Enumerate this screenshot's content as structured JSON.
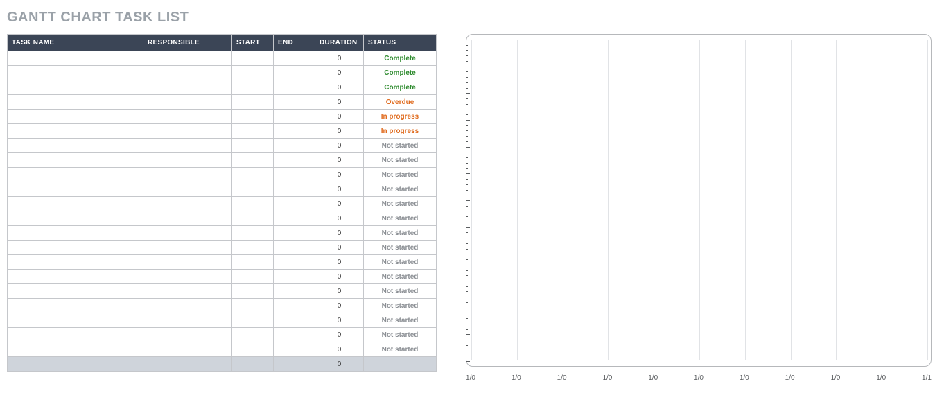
{
  "title": "GANTT CHART TASK LIST",
  "columns": {
    "task": "TASK NAME",
    "responsible": "RESPONSIBLE",
    "start": "START",
    "end": "END",
    "duration": "DURATION",
    "status": "STATUS"
  },
  "rows": [
    {
      "task": "",
      "responsible": "",
      "start": "",
      "end": "",
      "duration": "0",
      "status": "Complete",
      "statusClass": "complete"
    },
    {
      "task": "",
      "responsible": "",
      "start": "",
      "end": "",
      "duration": "0",
      "status": "Complete",
      "statusClass": "complete"
    },
    {
      "task": "",
      "responsible": "",
      "start": "",
      "end": "",
      "duration": "0",
      "status": "Complete",
      "statusClass": "complete"
    },
    {
      "task": "",
      "responsible": "",
      "start": "",
      "end": "",
      "duration": "0",
      "status": "Overdue",
      "statusClass": "overdue"
    },
    {
      "task": "",
      "responsible": "",
      "start": "",
      "end": "",
      "duration": "0",
      "status": "In progress",
      "statusClass": "inprogress"
    },
    {
      "task": "",
      "responsible": "",
      "start": "",
      "end": "",
      "duration": "0",
      "status": "In progress",
      "statusClass": "inprogress"
    },
    {
      "task": "",
      "responsible": "",
      "start": "",
      "end": "",
      "duration": "0",
      "status": "Not started",
      "statusClass": "notstarted"
    },
    {
      "task": "",
      "responsible": "",
      "start": "",
      "end": "",
      "duration": "0",
      "status": "Not started",
      "statusClass": "notstarted"
    },
    {
      "task": "",
      "responsible": "",
      "start": "",
      "end": "",
      "duration": "0",
      "status": "Not started",
      "statusClass": "notstarted"
    },
    {
      "task": "",
      "responsible": "",
      "start": "",
      "end": "",
      "duration": "0",
      "status": "Not started",
      "statusClass": "notstarted"
    },
    {
      "task": "",
      "responsible": "",
      "start": "",
      "end": "",
      "duration": "0",
      "status": "Not started",
      "statusClass": "notstarted"
    },
    {
      "task": "",
      "responsible": "",
      "start": "",
      "end": "",
      "duration": "0",
      "status": "Not started",
      "statusClass": "notstarted"
    },
    {
      "task": "",
      "responsible": "",
      "start": "",
      "end": "",
      "duration": "0",
      "status": "Not started",
      "statusClass": "notstarted"
    },
    {
      "task": "",
      "responsible": "",
      "start": "",
      "end": "",
      "duration": "0",
      "status": "Not started",
      "statusClass": "notstarted"
    },
    {
      "task": "",
      "responsible": "",
      "start": "",
      "end": "",
      "duration": "0",
      "status": "Not started",
      "statusClass": "notstarted"
    },
    {
      "task": "",
      "responsible": "",
      "start": "",
      "end": "",
      "duration": "0",
      "status": "Not started",
      "statusClass": "notstarted"
    },
    {
      "task": "",
      "responsible": "",
      "start": "",
      "end": "",
      "duration": "0",
      "status": "Not started",
      "statusClass": "notstarted"
    },
    {
      "task": "",
      "responsible": "",
      "start": "",
      "end": "",
      "duration": "0",
      "status": "Not started",
      "statusClass": "notstarted"
    },
    {
      "task": "",
      "responsible": "",
      "start": "",
      "end": "",
      "duration": "0",
      "status": "Not started",
      "statusClass": "notstarted"
    },
    {
      "task": "",
      "responsible": "",
      "start": "",
      "end": "",
      "duration": "0",
      "status": "Not started",
      "statusClass": "notstarted"
    },
    {
      "task": "",
      "responsible": "",
      "start": "",
      "end": "",
      "duration": "0",
      "status": "Not started",
      "statusClass": "notstarted"
    }
  ],
  "footer": {
    "duration": "0"
  },
  "chart_data": {
    "type": "bar",
    "title": "",
    "xlabel": "",
    "ylabel": "",
    "x_ticks": [
      "1/0",
      "1/0",
      "1/0",
      "1/0",
      "1/0",
      "1/0",
      "1/0",
      "1/0",
      "1/0",
      "1/0",
      "1/1"
    ],
    "y_tick_count": 60,
    "series": [],
    "categories": [],
    "values": []
  }
}
